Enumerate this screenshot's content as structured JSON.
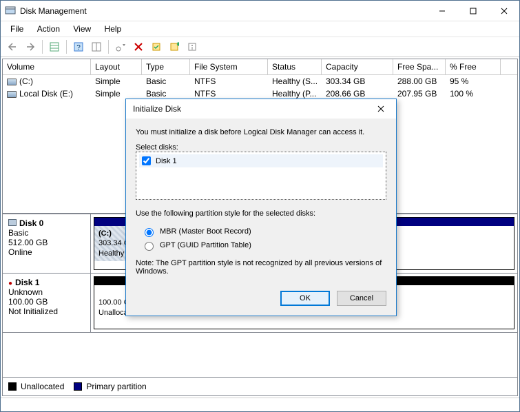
{
  "window": {
    "title": "Disk Management",
    "menus": [
      "File",
      "Action",
      "View",
      "Help"
    ]
  },
  "columns": [
    "Volume",
    "Layout",
    "Type",
    "File System",
    "Status",
    "Capacity",
    "Free Spa...",
    "% Free"
  ],
  "volumes": [
    {
      "name": "(C:)",
      "layout": "Simple",
      "type": "Basic",
      "fs": "NTFS",
      "status": "Healthy (S...",
      "capacity": "303.34 GB",
      "free": "288.00 GB",
      "pct": "95 %"
    },
    {
      "name": "Local Disk (E:)",
      "layout": "Simple",
      "type": "Basic",
      "fs": "NTFS",
      "status": "Healthy (P...",
      "capacity": "208.66 GB",
      "free": "207.95 GB",
      "pct": "100 %"
    }
  ],
  "disks": [
    {
      "name": "Disk 0",
      "type": "Basic",
      "size": "512.00 GB",
      "state": "Online",
      "parts": [
        {
          "label": "(C:)",
          "line2": "303.34 GB N",
          "line3": "Healthy (Sy",
          "primary": true,
          "hatch": true
        }
      ]
    },
    {
      "name": "Disk 1",
      "type": "Unknown",
      "size": "100.00 GB",
      "state": "Not Initialized",
      "err": true,
      "parts": [
        {
          "label": "",
          "line2": "100.00 GB",
          "line3": "Unallocated",
          "primary": false
        }
      ]
    }
  ],
  "legend": {
    "unalloc": "Unallocated",
    "primary": "Primary partition"
  },
  "dialog": {
    "title": "Initialize Disk",
    "msg": "You must initialize a disk before Logical Disk Manager can access it.",
    "selectLabel": "Select disks:",
    "diskItem": "Disk 1",
    "styleLabel": "Use the following partition style for the selected disks:",
    "mbr": "MBR (Master Boot Record)",
    "gpt": "GPT (GUID Partition Table)",
    "note": "Note: The GPT partition style is not recognized by all previous versions of Windows.",
    "ok": "OK",
    "cancel": "Cancel"
  }
}
